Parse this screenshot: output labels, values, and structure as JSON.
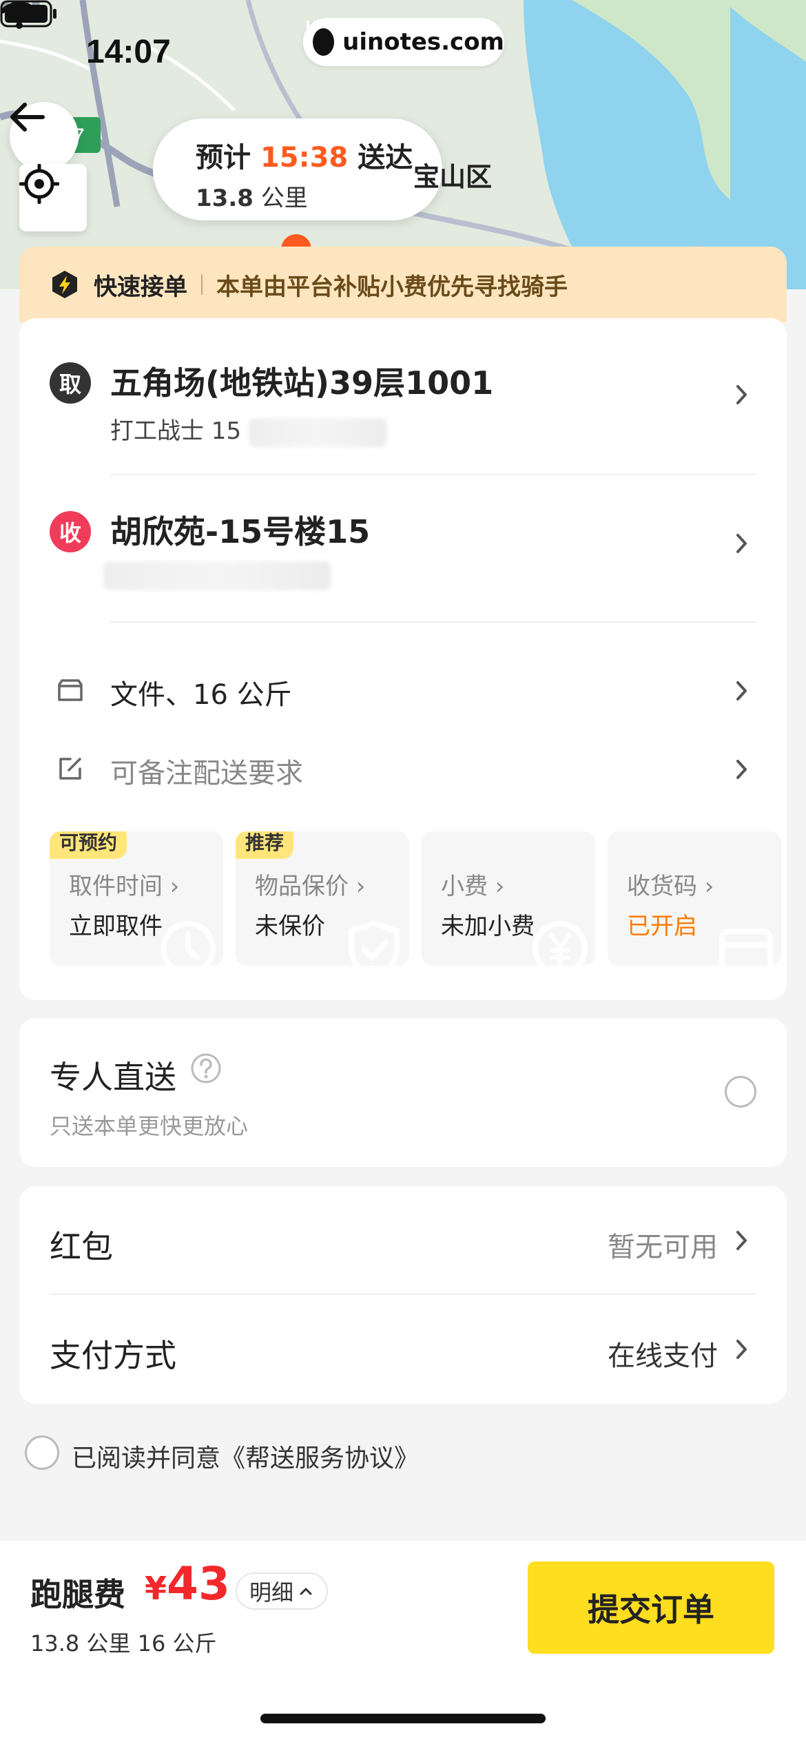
{
  "status_bar": {
    "time": "14:07",
    "site": "uinotes.com"
  },
  "map": {
    "eta_prefix": "预计",
    "eta_time": "15:38",
    "eta_suffix": "送达",
    "distance_value": "13.8",
    "distance_unit": "公里",
    "district_label": "宝山区"
  },
  "banner": {
    "title": "快速接单",
    "text": "本单由平台补贴小费优先寻找骑手"
  },
  "pickup": {
    "badge": "取",
    "address": "五角场(地铁站)39层1001",
    "contact_prefix": "打工战士  15"
  },
  "dropoff": {
    "badge": "收",
    "address": "胡欣苑-15号楼15"
  },
  "options": {
    "item": "文件、16 公斤",
    "note": "可备注配送要求"
  },
  "tiles": [
    {
      "tag": "可预约",
      "label": "取件时间",
      "value": "立即取件"
    },
    {
      "tag": "推荐",
      "label": "物品保价",
      "value": "未保价"
    },
    {
      "tag": "",
      "label": "小费",
      "value": "未加小费"
    },
    {
      "tag": "",
      "label": "收货码",
      "value": "已开启"
    }
  ],
  "direct": {
    "title": "专人直送",
    "subtitle": "只送本单更快更放心"
  },
  "payment": {
    "red_packet_label": "红包",
    "red_packet_value": "暂无可用",
    "method_label": "支付方式",
    "method_value": "在线支付"
  },
  "agreement": {
    "text": "已阅读并同意《帮送服务协议》"
  },
  "bottom": {
    "fee_label": "跑腿费",
    "currency": "¥",
    "amount": "43",
    "detail_label": "明细",
    "summary": "13.8 公里 16 公斤",
    "submit_label": "提交订单"
  },
  "colors": {
    "accent_yellow": "#ffdd1f",
    "price_red": "#f2282a",
    "eta_orange": "#ff5a1f",
    "banner_bg": "#fde6bf",
    "dropoff_badge": "#f03c5a",
    "pickup_badge": "#333333"
  }
}
